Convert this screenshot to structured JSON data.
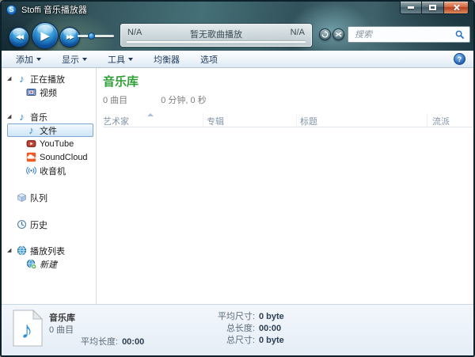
{
  "window": {
    "title": "Stoffi 音乐播放器",
    "controls": [
      "minimize-icon",
      "maximize-icon",
      "close-icon"
    ]
  },
  "glyphs": {
    "logo": "S",
    "previous": "◀◀",
    "play": "▶",
    "next": "▶▶",
    "help": "?",
    "music_note": "♪",
    "expander": "◢"
  },
  "toolbar": {
    "transport": [
      "previous-button",
      "play-button",
      "next-button"
    ],
    "volume": {
      "position_percent": 38
    },
    "now_playing": {
      "elapsed": "N/A",
      "song": "暂无歌曲播放",
      "remaining": "N/A",
      "progress_percent": 0
    },
    "mode_buttons": [
      "repeat-icon",
      "shuffle-icon"
    ],
    "search": {
      "placeholder": "搜索",
      "value": "",
      "icon": "magnifier-icon"
    }
  },
  "menubar": {
    "items": [
      {
        "label": "添加",
        "dropdown": true
      },
      {
        "label": "显示",
        "dropdown": true
      },
      {
        "label": "工具",
        "dropdown": true
      },
      {
        "label": "均衡器",
        "dropdown": false
      },
      {
        "label": "选项",
        "dropdown": false
      }
    ],
    "help_icon": "help-icon"
  },
  "sidebar": {
    "items": [
      {
        "label": "正在播放",
        "icon": "music-note-icon",
        "level": 0,
        "expanded": true
      },
      {
        "label": "视频",
        "icon": "video-icon",
        "level": 1
      },
      {
        "label": "音乐",
        "icon": "music-note-icon",
        "level": 0,
        "expanded": true
      },
      {
        "label": "文件",
        "icon": "music-note-icon",
        "level": 1,
        "selected": true
      },
      {
        "label": "YouTube",
        "icon": "youtube-icon",
        "level": 1
      },
      {
        "label": "SoundCloud",
        "icon": "soundcloud-icon",
        "level": 1
      },
      {
        "label": "收音机",
        "icon": "radio-icon",
        "level": 1
      },
      {
        "label": "队列",
        "icon": "queue-icon",
        "level": 0
      },
      {
        "label": "历史",
        "icon": "history-icon",
        "level": 0
      },
      {
        "label": "播放列表",
        "icon": "playlist-icon",
        "level": 0,
        "expanded": true
      },
      {
        "label": "新建",
        "icon": "new-playlist-icon",
        "level": 1,
        "italic": true
      }
    ]
  },
  "library": {
    "title": "音乐库",
    "track_count": "0 曲目",
    "duration": "0 分钟, 0 秒",
    "columns": [
      "艺术家",
      "专辑",
      "标题",
      "流派"
    ],
    "sort": {
      "column": "艺术家",
      "direction": "ascending"
    }
  },
  "statusbar": {
    "icon": "music-file-icon",
    "source_title": "音乐库",
    "track_count": "0 曲目",
    "avg_length": {
      "label": "平均长度:",
      "value": "00:00"
    },
    "metrics": [
      {
        "label": "平均尺寸:",
        "value": "0 byte"
      },
      {
        "label": "总长度:",
        "value": "00:00"
      },
      {
        "label": "总尺寸:",
        "value": "0 byte"
      }
    ]
  },
  "colors": {
    "library_title_green": "#2e9e35",
    "close_button_red": "#c24a2b",
    "accent_blue": "#2a6fc9",
    "selection_border": "#7fa8d9",
    "glass_teal": "#35565e"
  }
}
